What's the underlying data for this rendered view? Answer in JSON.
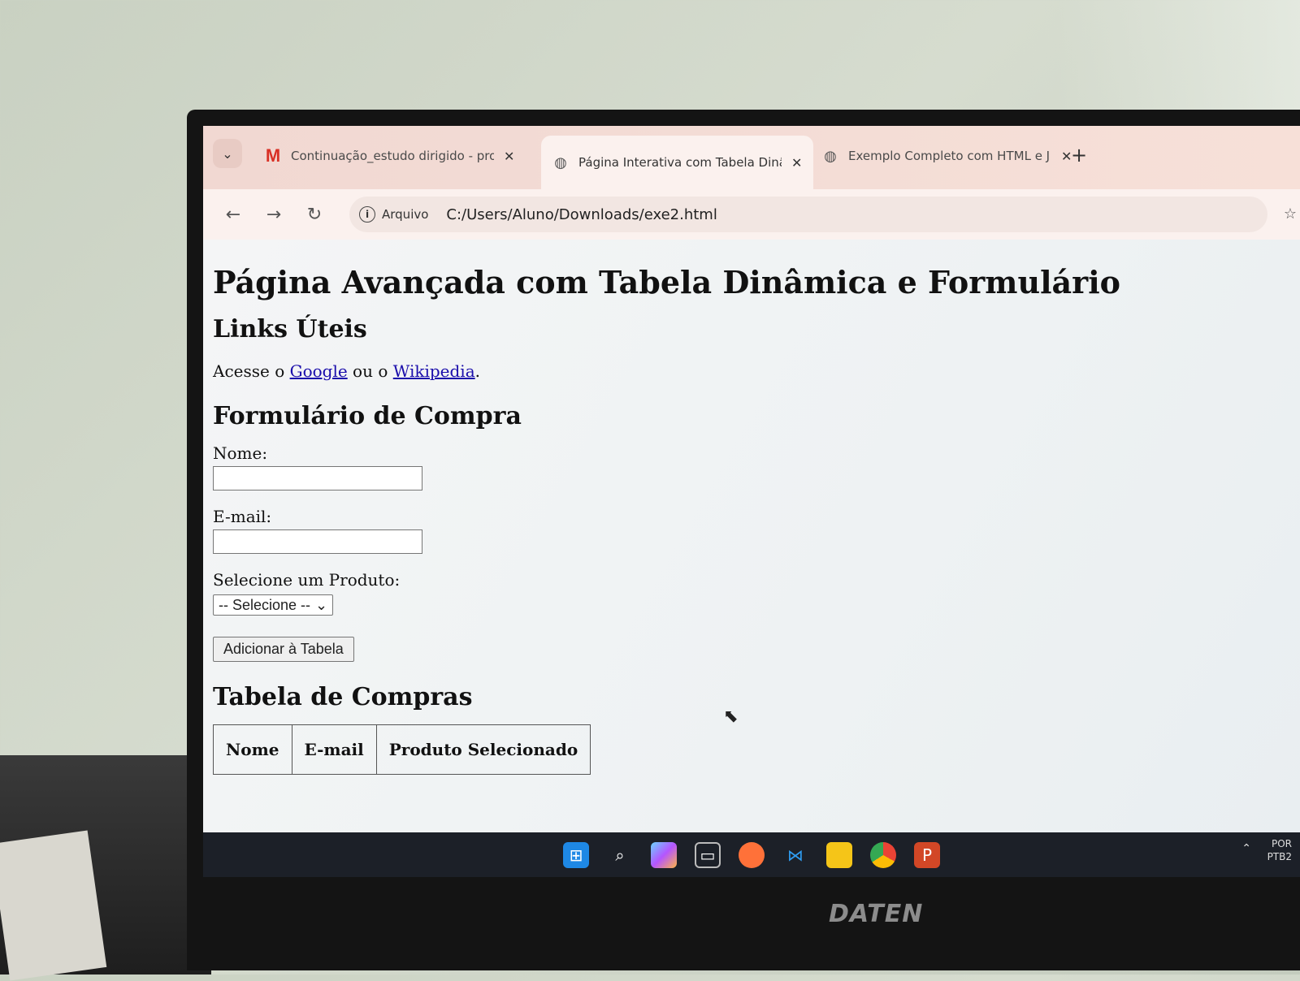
{
  "tabs": [
    {
      "title": "Continuação_estudo dirigido - pro",
      "icon": "gmail-icon",
      "active": false
    },
    {
      "title": "Página Interativa com Tabela Dinâ",
      "icon": "globe-icon",
      "active": true
    },
    {
      "title": "Exemplo Completo com HTML e J",
      "icon": "globe-icon",
      "active": false
    }
  ],
  "toolbar": {
    "chip_label": "Arquivo",
    "url": "C:/Users/Aluno/Downloads/exe2.html"
  },
  "page": {
    "title": "Página Avançada com Tabela Dinâmica e Formulário",
    "links_heading": "Links Úteis",
    "links_prefix": "Acesse o ",
    "link_google": "Google",
    "links_middle": " ou o ",
    "link_wikipedia": "Wikipedia",
    "links_suffix": ".",
    "form_heading": "Formulário de Compra",
    "name_label": "Nome:",
    "email_label": "E-mail:",
    "product_label": "Selecione um Produto:",
    "product_select_value": "-- Selecione --",
    "add_button": "Adicionar à Tabela",
    "table_heading": "Tabela de Compras",
    "table_columns": [
      "Nome",
      "E-mail",
      "Produto Selecionado"
    ]
  },
  "taskbar": {
    "tray_lang_1": "POR",
    "tray_lang_2": "PTB2"
  },
  "monitor_brand": "DATEN"
}
